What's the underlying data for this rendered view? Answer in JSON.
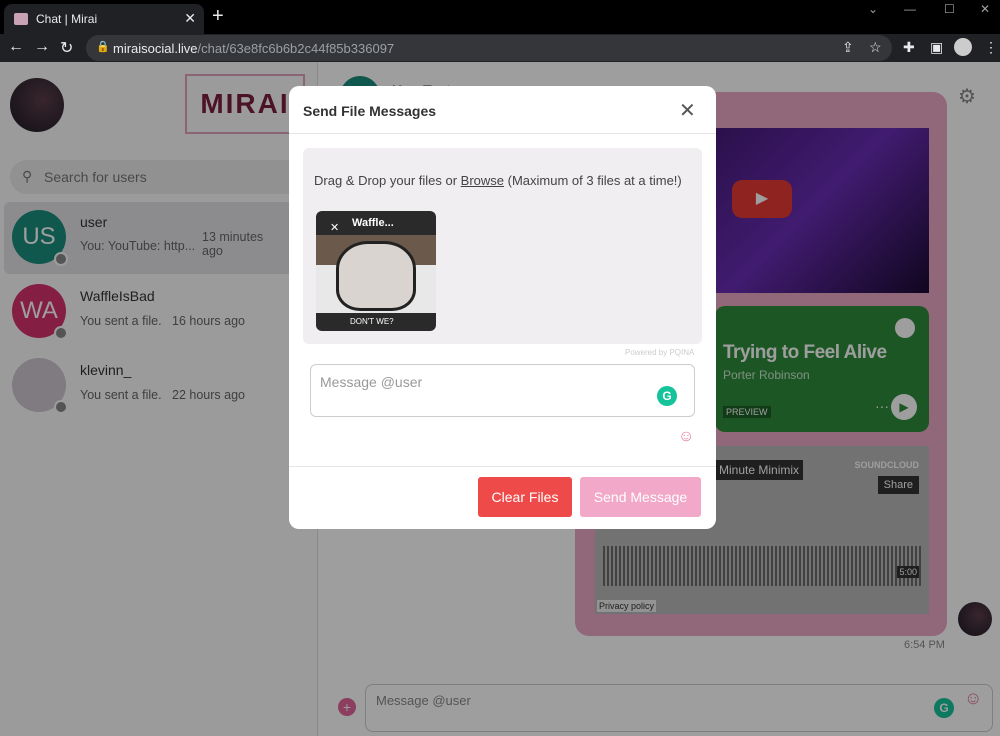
{
  "browser": {
    "tab_title": "Chat | Mirai",
    "tab_close": "✕",
    "new_tab": "+",
    "url_host": "miraisocial.live",
    "url_path": "/chat/63e8fc6b6b2c44f85b336097"
  },
  "sidebar": {
    "logo_text": "MIRAI",
    "search_placeholder": "Search for users",
    "users": [
      {
        "initials": "US",
        "name": "user",
        "preview": "You: YouTube: http...",
        "time": "13 minutes ago",
        "color": "#1a8f7d"
      },
      {
        "initials": "WA",
        "name": "WaffleIsBad",
        "preview": "You sent a file.",
        "time": "16 hours ago",
        "color": "#d6336c"
      },
      {
        "initials": "",
        "name": "klevinn_",
        "preview": "You sent a file.",
        "time": "22 hours ago",
        "color": "#cfc7cf"
      }
    ]
  },
  "chat": {
    "header_name": "UserTest",
    "spotify_song": "Trying to Feel Alive",
    "spotify_artist": "Porter Robinson",
    "spotify_preview": "PREVIEW",
    "soundcloud_title": "Minute Minimix",
    "soundcloud_brand": "SOUNDCLOUD",
    "soundcloud_share": "Share",
    "soundcloud_duration": "5:00",
    "soundcloud_privacy": "Privacy policy",
    "message_time": "6:54 PM",
    "composer_placeholder": "Message @user"
  },
  "modal": {
    "title": "Send File Messages",
    "close": "✕",
    "drop_prefix": "Drag & Drop your files or ",
    "browse": "Browse",
    "drop_suffix": " (Maximum of 3 files at a time!)",
    "file_name": "Waffle...",
    "file_remove": "✕",
    "thumb_caption": "DON'T WE?",
    "powered_by": "Powered by PQINA",
    "message_placeholder": "Message @user",
    "clear_button": "Clear Files",
    "send_button": "Send Message"
  },
  "colors": {
    "accent_pink": "#e9a8c3",
    "clear_red": "#ef4a4a",
    "send_pink": "#f2a8c8"
  }
}
